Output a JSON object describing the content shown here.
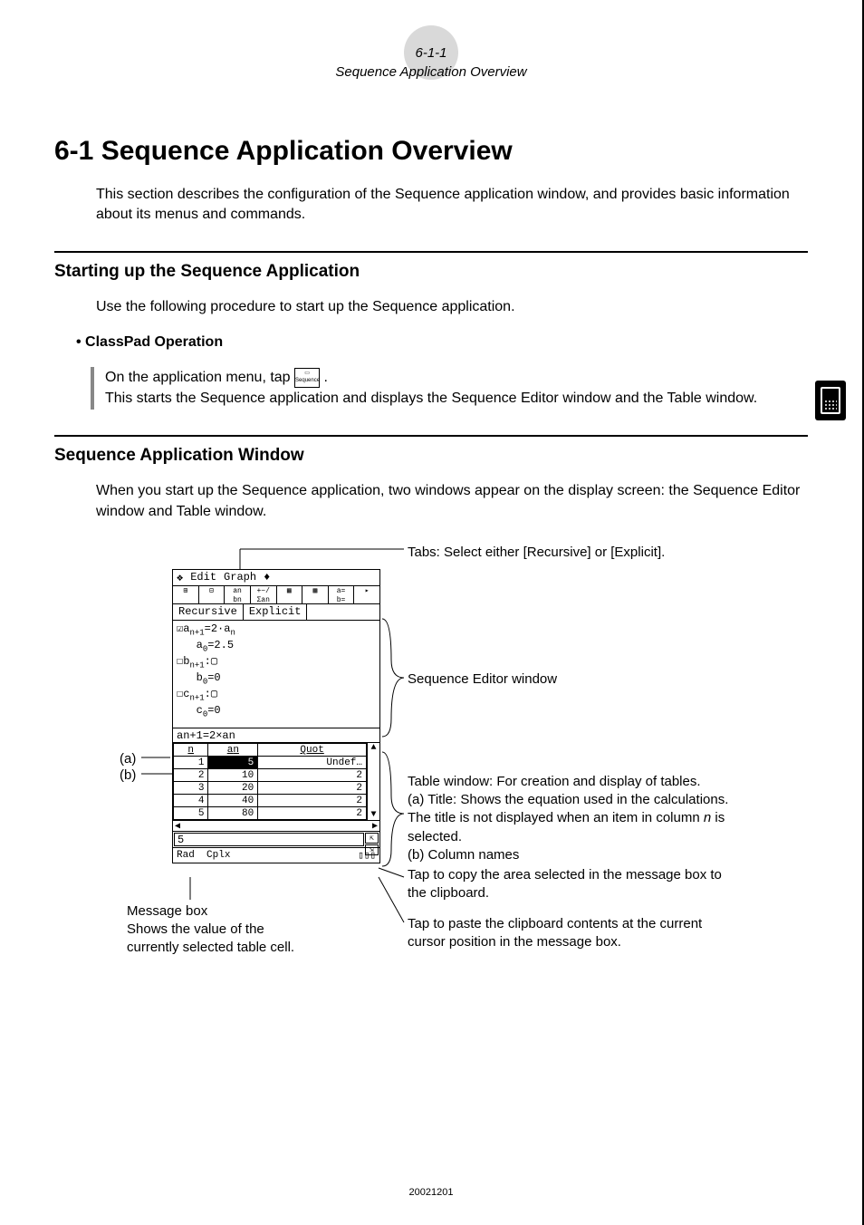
{
  "header": {
    "pagecode": "6-1-1",
    "section_name": "Sequence Application Overview"
  },
  "title": "6-1 Sequence Application Overview",
  "intro": "This section describes the configuration of the Sequence application window, and provides basic information about its menus and commands.",
  "h2a": "Starting up the Sequence Application",
  "body_a": "Use the following procedure to start up the Sequence application.",
  "op_heading": "• ClassPad Operation",
  "op_line1a": "On the application menu, tap ",
  "op_line1b": ".",
  "op_line2": "This starts the Sequence application and displays the Sequence Editor window and the Table window.",
  "h2b": "Sequence Application Window",
  "body_b": "When you start up the Sequence application, two windows appear on the display screen: the Sequence Editor window and Table window.",
  "screen": {
    "menu": {
      "edit": "Edit",
      "graph": "Graph",
      "arrow": "♦"
    },
    "tabs": {
      "recursive": "Recursive",
      "explicit": "Explicit"
    },
    "editor_lines": [
      "☑a_{n+1}=2·a_n",
      "   a_0=2.5",
      "☐b_{n+1}:□",
      "   b_0=0",
      "☐c_{n+1}:□",
      "   c_0=0"
    ],
    "table_title": "a_{n+1}=2×a_n",
    "cols": [
      "n",
      "a_n",
      "Quot"
    ],
    "rows": [
      [
        "1",
        "5",
        "Undef…"
      ],
      [
        "2",
        "10",
        "2"
      ],
      [
        "3",
        "20",
        "2"
      ],
      [
        "4",
        "40",
        "2"
      ],
      [
        "5",
        "80",
        "2"
      ]
    ],
    "selected_cell": "5",
    "msgbox_value": "5",
    "status": {
      "rad": "Rad",
      "cplx": "Cplx",
      "batt": "▯▯▯"
    }
  },
  "labels": {
    "a": "(a)",
    "b": "(b)",
    "tabs": "Tabs: Select either [Recursive] or [Explicit].",
    "editor": "Sequence Editor window",
    "table1": "Table window: For creation and display of tables.",
    "table2a": "(a) Title: Shows the equation used in the calculations. The title is not displayed when an item in column ",
    "table2n": "n",
    "table2b": " is selected.",
    "table3": "(b) Column names",
    "copy": "Tap to copy the area selected in the message box to the clipboard.",
    "paste": "Tap to paste the clipboard contents at the current cursor position in the message box.",
    "msgbox1": "Message box",
    "msgbox2": "Shows the value of the currently selected table cell."
  },
  "footer": "20021201"
}
